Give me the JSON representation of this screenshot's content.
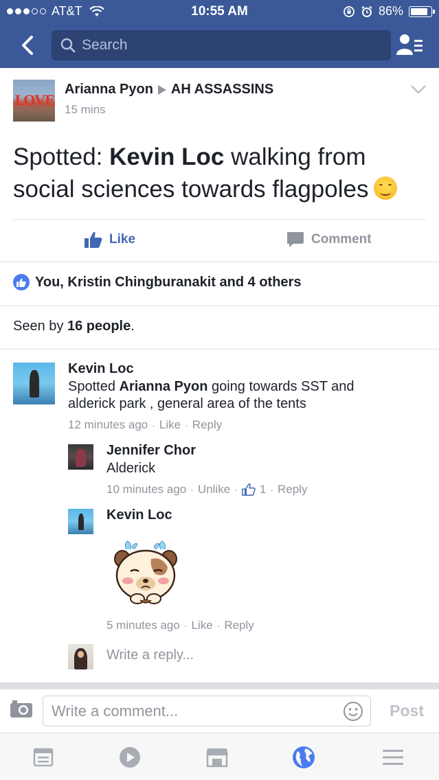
{
  "status_bar": {
    "carrier": "AT&T",
    "time": "10:55 AM",
    "battery": "86%",
    "battery_level": 0.86
  },
  "nav": {
    "search_placeholder": "Search"
  },
  "post": {
    "author": "Arianna Pyon",
    "group": "AH ASSASSINS",
    "time": "15 mins",
    "text_prefix": "Spotted: ",
    "text_bold": "Kevin Loc",
    "text_rest": " walking from social sciences towards flagpoles",
    "emoji": "smiling-face",
    "like_label": "Like",
    "comment_label": "Comment",
    "reactions_text": "You, Kristin Chingburanakit and 4 others",
    "seen_prefix": "Seen by ",
    "seen_count": "16 people",
    "seen_suffix": "."
  },
  "comments": [
    {
      "name": "Kevin Loc",
      "body_prefix": "Spotted ",
      "body_bold": "Arianna Pyon",
      "body_rest": " going towards SST and alderick park , general area of the tents",
      "time": "12 minutes ago",
      "action1": "Like",
      "action2": "Reply"
    }
  ],
  "replies": [
    {
      "name": "Jennifer Chor",
      "body": "Alderick",
      "time": "10 minutes ago",
      "action1": "Unlike",
      "like_count": "1",
      "action2": "Reply"
    },
    {
      "name": "Kevin Loc",
      "sticker": "sticker-bear-crying",
      "time": "5 minutes ago",
      "action1": "Like",
      "action2": "Reply"
    }
  ],
  "reply_placeholder": "Write a reply...",
  "composer": {
    "placeholder": "Write a comment...",
    "post_label": "Post"
  },
  "tabs": [
    "news-feed-icon",
    "video-icon",
    "marketplace-icon",
    "globe-icon",
    "menu-icon"
  ],
  "colors": {
    "brand": "#3b5998",
    "link_blue": "#4267b2",
    "meta_gray": "#90949c",
    "active_tab": "#4b7bf0"
  }
}
